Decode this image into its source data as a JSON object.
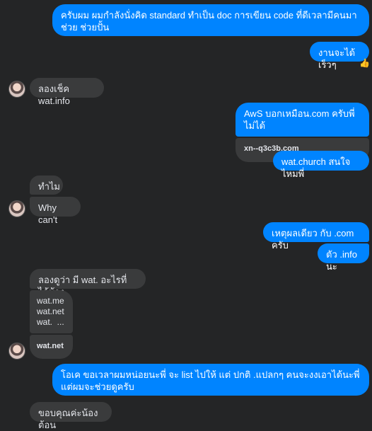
{
  "messages": {
    "m1": "ครับผม ผมกำลังนั่งคิด standard ทำเป็น doc การเขียน code ที่ดีเวลามีคนมาช่วย ช่วยปั้น",
    "m2": "งานจะได้เร็วๆ",
    "m2_reaction": "👍",
    "m3": "ลองเช็ค wat.info",
    "m4": "AwS บอกเหมือน.com ครับพี่ ไม่ได้",
    "m4_link": "xn--q3c3b.com",
    "m5": "wat.church สนใจไหมพี่",
    "m6": "ทำไม",
    "m7": "Why can't",
    "m8": "เหตุผลเดียว กับ .com ครับ",
    "m9": "ตัว .info นะ",
    "m10": "ลองดูว่า มี wat. อะไรที่ได้บ้าง",
    "m11_list": "wat.me\nwat.net\nwat.  ...",
    "m11_link": "wat.net",
    "m12": "โอเค ขอเวลาผมหน่อยนะพี่ จะ list ไปให้ แต่ ปกติ .แปลกๆ คนจะงงเอาได้นะพี่ แต่ผมจะช่วยดูครับ",
    "m13": "ขอบคุณค่ะน้องต้อน"
  }
}
